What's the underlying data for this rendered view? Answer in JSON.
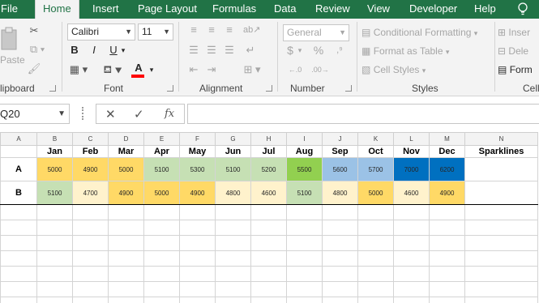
{
  "menu": {
    "tabs": [
      "File",
      "Home",
      "Insert",
      "Page Layout",
      "Formulas",
      "Data",
      "Review",
      "View",
      "Developer",
      "Help"
    ],
    "active": "Home"
  },
  "ribbon": {
    "clipboard": {
      "paste": "Paste",
      "label": "lipboard"
    },
    "font": {
      "name": "Calibri",
      "size": "11",
      "label": "Font",
      "bold": "B",
      "italic": "I",
      "underline": "U",
      "font_color": "A",
      "font_color_swatch": "#ff0000"
    },
    "alignment": {
      "label": "Alignment"
    },
    "number": {
      "format": "General",
      "currency": "$",
      "percent": "%",
      "label": "Number"
    },
    "styles": {
      "conditional": "Conditional Formatting",
      "format_table": "Format as Table",
      "cell_styles": "Cell Styles",
      "label": "Styles"
    },
    "cells": {
      "insert": "Inser",
      "delete": "Dele",
      "format": "Form",
      "label": "Cell"
    }
  },
  "formula_bar": {
    "name_box": "Q20",
    "cancel": "✕",
    "enter": "✓",
    "fx": "fx",
    "formula": ""
  },
  "sheet": {
    "columns": [
      "A",
      "B",
      "C",
      "D",
      "E",
      "F",
      "G",
      "H",
      "I",
      "J",
      "K",
      "L",
      "M",
      "N"
    ],
    "months": [
      "Jan",
      "Feb",
      "Mar",
      "Apr",
      "May",
      "Jun",
      "Jul",
      "Aug",
      "Sep",
      "Oct",
      "Nov",
      "Dec"
    ],
    "sparklines_header": "Sparklines",
    "rows": [
      {
        "label": "A",
        "values": [
          "5000",
          "4900",
          "5000",
          "5100",
          "5300",
          "5100",
          "5200",
          "5500",
          "5600",
          "5700",
          "7000",
          "6200"
        ],
        "colors": [
          "#ffd966",
          "#ffd966",
          "#ffd966",
          "#c6e0b4",
          "#c6e0b4",
          "#c6e0b4",
          "#c6e0b4",
          "#92d050",
          "#9bc2e6",
          "#9bc2e6",
          "#0070c0",
          "#0070c0"
        ]
      },
      {
        "label": "B",
        "values": [
          "5100",
          "4700",
          "4900",
          "5000",
          "4900",
          "4800",
          "4600",
          "5100",
          "4800",
          "5000",
          "4600",
          "4900"
        ],
        "colors": [
          "#c6e0b4",
          "#fff2cc",
          "#ffd966",
          "#ffd966",
          "#ffd966",
          "#fff2cc",
          "#fff2cc",
          "#c6e0b4",
          "#fff2cc",
          "#ffd966",
          "#fff2cc",
          "#ffd966"
        ]
      }
    ]
  },
  "colors": {
    "excel_green": "#217346",
    "ribbon_bg": "#f3f3f3",
    "grid_line": "#d4d4d4"
  }
}
